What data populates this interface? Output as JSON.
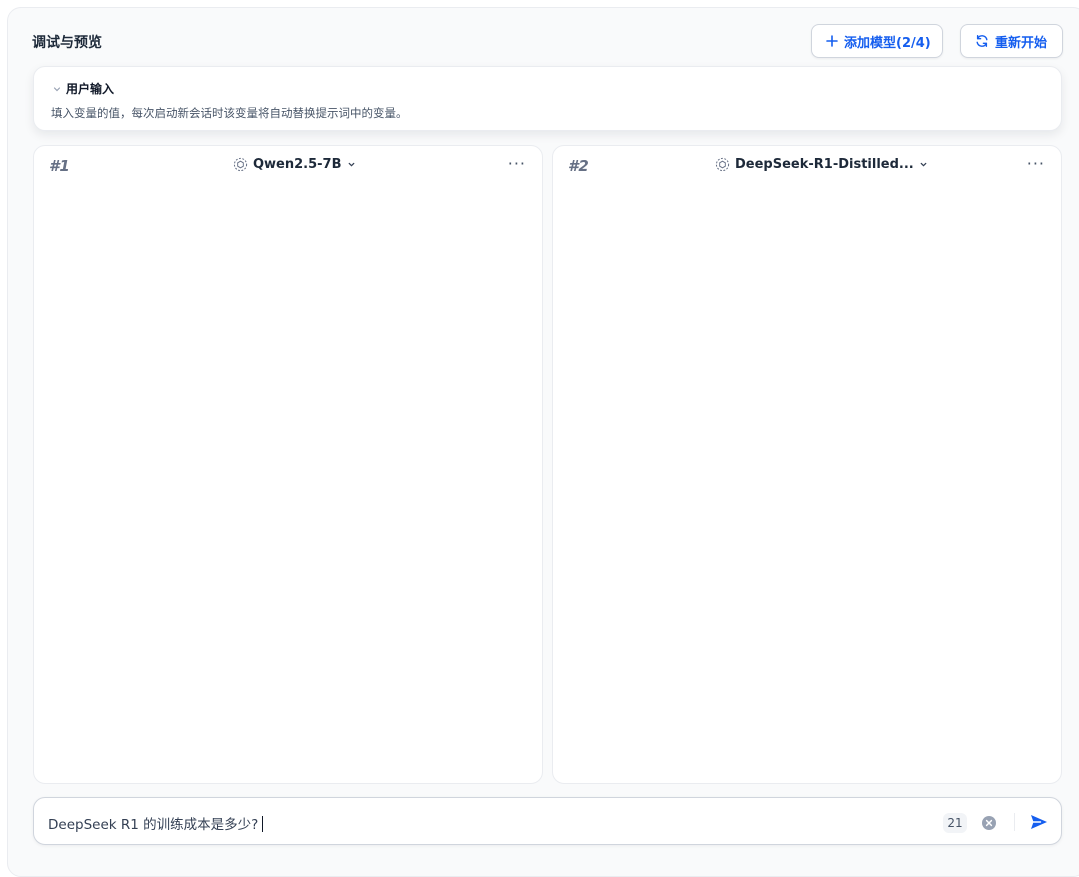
{
  "header": {
    "title": "调试与预览",
    "add_model_label": "添加模型(2/4)",
    "restart_label": "重新开始"
  },
  "user_input": {
    "title": "用户输入",
    "description": "填入变量的值，每次启动新会话时该变量将自动替换提示词中的变量。"
  },
  "panels": [
    {
      "index": "#1",
      "model": "Qwen2.5-7B"
    },
    {
      "index": "#2",
      "model": "DeepSeek-R1-Distilled..."
    }
  ],
  "chat": {
    "value": "DeepSeek R1 的训练成本是多少?",
    "char_count": "21"
  },
  "colors": {
    "accent": "#155eef",
    "border": "#eaecf0",
    "background": "#f9fafb"
  }
}
